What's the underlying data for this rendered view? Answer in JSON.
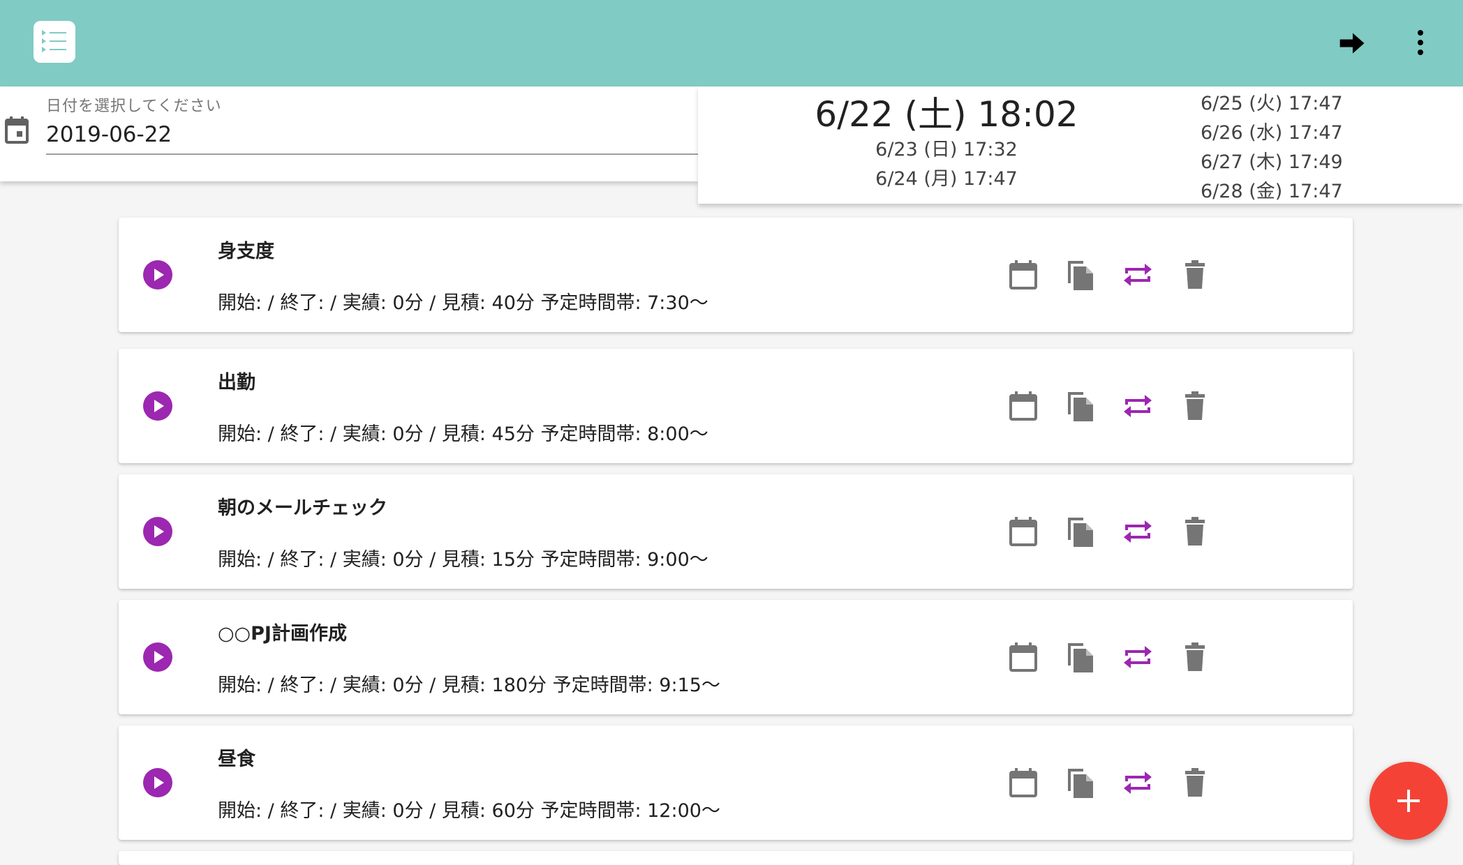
{
  "colors": {
    "appbar": "#80cbc4",
    "accent": "#9c27b0",
    "fab": "#f44336",
    "icon_gray": "#757575"
  },
  "appbar": {
    "logo_icon": "list-icon",
    "forward_icon": "arrow-forward-icon",
    "more_icon": "more-vert-icon"
  },
  "date_picker": {
    "label": "日付を選択してください",
    "value": "2019-06-22",
    "icon": "calendar-icon"
  },
  "schedule": {
    "current": "6/22 (土) 18:02",
    "left_list": [
      "6/23 (日) 17:32",
      "6/24 (月) 17:47"
    ],
    "right_list": [
      "6/25 (火) 17:47",
      "6/26 (水) 17:47",
      "6/27 (木) 17:49",
      "6/28 (金) 17:47"
    ]
  },
  "tasks": [
    {
      "title": "身支度",
      "detail": "開始: / 終了: / 実績: 0分 / 見積: 40分 予定時間帯: 7:30〜"
    },
    {
      "title": "出勤",
      "detail": "開始: / 終了: / 実績: 0分 / 見積: 45分 予定時間帯: 8:00〜"
    },
    {
      "title": "朝のメールチェック",
      "detail": "開始: / 終了: / 実績: 0分 / 見積: 15分 予定時間帯: 9:00〜"
    },
    {
      "title": "○○PJ計画作成",
      "detail": "開始: / 終了: / 実績: 0分 / 見積: 180分 予定時間帯: 9:15〜"
    },
    {
      "title": "昼食",
      "detail": "開始: / 終了: / 実績: 0分 / 見積: 60分 予定時間帯: 12:00〜"
    }
  ],
  "task_actions": [
    "play-icon",
    "calendar-icon",
    "copy-icon",
    "repeat-icon",
    "delete-icon"
  ],
  "fab": {
    "icon": "add-icon"
  }
}
